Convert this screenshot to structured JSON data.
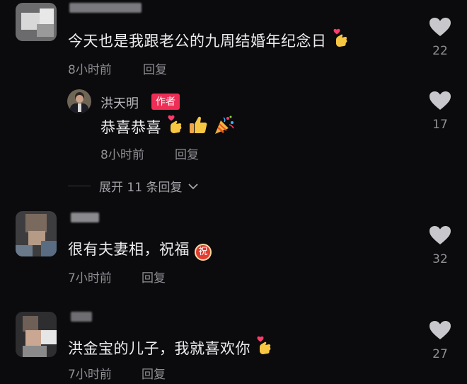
{
  "comments": [
    {
      "text": "今天也是我跟老公的九周结婚年纪念日",
      "time": "8小时前",
      "reply": "回复",
      "likes": "22",
      "emoji": [
        "finger-heart"
      ]
    },
    {
      "author": "洪天明",
      "author_badge": "作者",
      "text": "恭喜恭喜",
      "time": "8小时前",
      "reply": "回复",
      "likes": "17",
      "emoji": [
        "finger-heart",
        "thumbs-up",
        "party-popper"
      ]
    },
    {
      "text": "很有夫妻相，祝福",
      "time": "7小时前",
      "reply": "回复",
      "likes": "32",
      "emoji": [
        "blessing-badge"
      ],
      "blessing_char": "祝"
    },
    {
      "text": "洪金宝的儿子，我就喜欢你",
      "time": "7小时前",
      "reply": "回复",
      "likes": "27",
      "emoji": [
        "finger-heart"
      ]
    }
  ],
  "expand_replies": "展开 11 条回复",
  "colors": {
    "background": "#0b0b0d",
    "badge": "#ef2d55",
    "meta": "#8e8e93",
    "heart": "#c7c7cc"
  },
  "icons": [
    "heart-icon",
    "chevron-down-icon"
  ]
}
